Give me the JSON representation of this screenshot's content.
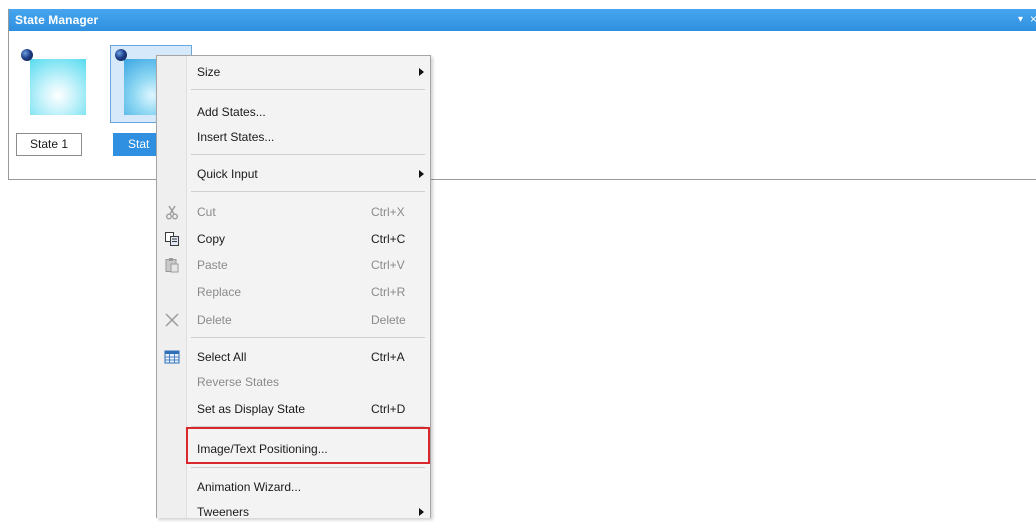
{
  "panel": {
    "title": "State Manager",
    "controls": {
      "dropdown": "▾",
      "close": "×"
    }
  },
  "states": [
    {
      "label": "State 1"
    },
    {
      "label": "Stat"
    }
  ],
  "menu": {
    "items": {
      "size": "Size",
      "add_states": "Add States...",
      "insert_states": "Insert States...",
      "quick_input": "Quick Input",
      "cut": {
        "label": "Cut",
        "shortcut": "Ctrl+X"
      },
      "copy": {
        "label": "Copy",
        "shortcut": "Ctrl+C"
      },
      "paste": {
        "label": "Paste",
        "shortcut": "Ctrl+V"
      },
      "replace": {
        "label": "Replace",
        "shortcut": "Ctrl+R"
      },
      "delete": {
        "label": "Delete",
        "shortcut": "Delete"
      },
      "select_all": {
        "label": "Select All",
        "shortcut": "Ctrl+A"
      },
      "reverse_states": "Reverse States",
      "set_display": {
        "label": "Set as Display State",
        "shortcut": "Ctrl+D"
      },
      "image_text_positioning": "Image/Text Positioning...",
      "animation_wizard": "Animation Wizard...",
      "tweeners": "Tweeners"
    }
  },
  "colors": {
    "titlebar": "#2f8fe0",
    "highlight": "#d9272e",
    "selection": "#2f8fe0"
  }
}
